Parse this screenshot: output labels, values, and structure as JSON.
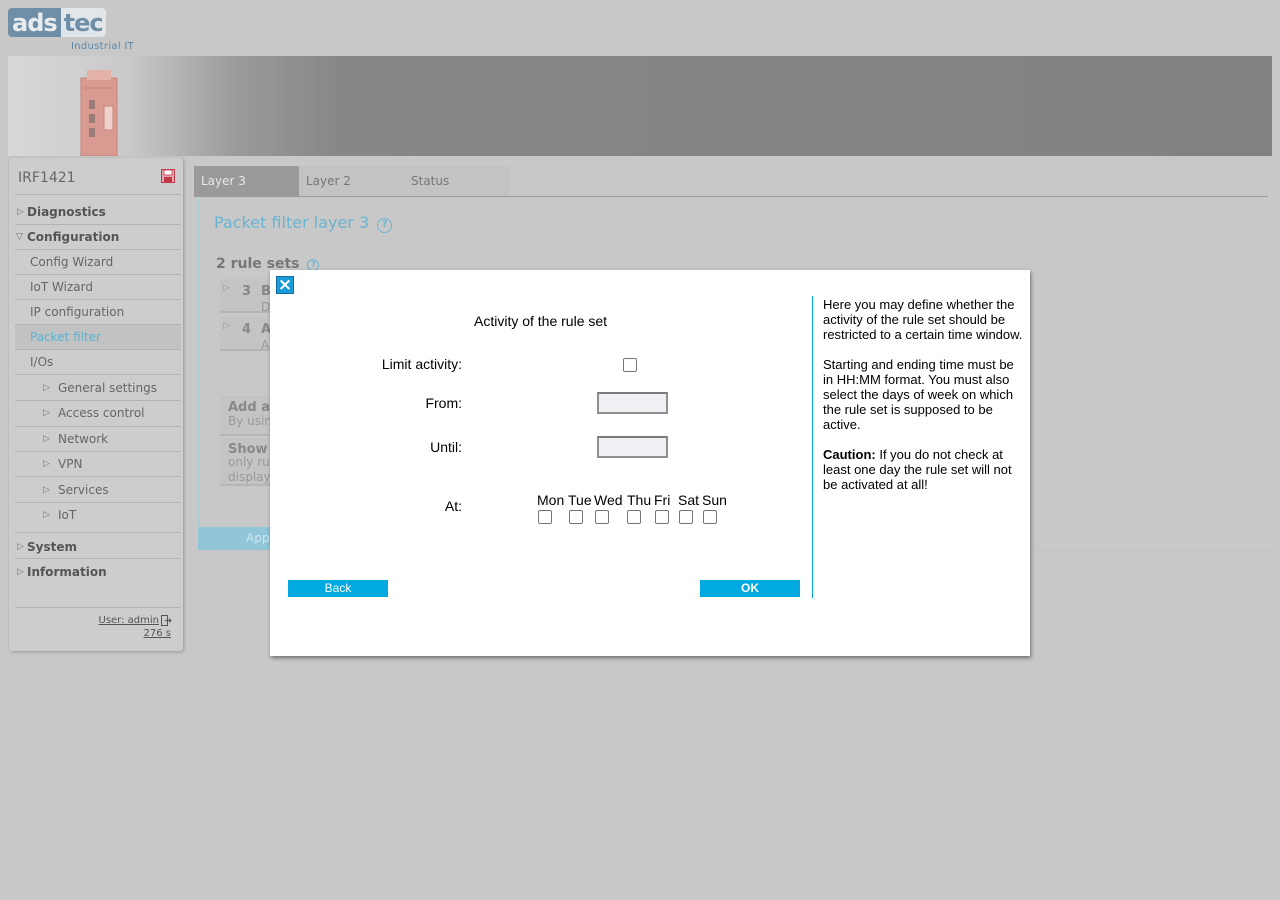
{
  "brand": {
    "logo_left": "ads",
    "logo_right": "tec",
    "tagline": "Industrial IT"
  },
  "colors": {
    "accent": "#00a9e0",
    "title_blue": "#6ab4cf",
    "close_blue": "#1a9bd7"
  },
  "sidebar": {
    "device_name": "IRF1421",
    "items": [
      {
        "label": "Diagnostics",
        "level": "top",
        "expanded": false
      },
      {
        "label": "Configuration",
        "level": "top",
        "expanded": true
      },
      {
        "label": "Config Wizard",
        "level": "sub"
      },
      {
        "label": "IoT Wizard",
        "level": "sub"
      },
      {
        "label": "IP configuration",
        "level": "sub"
      },
      {
        "label": "Packet filter",
        "level": "sub",
        "active": true
      },
      {
        "label": "I/Os",
        "level": "sub"
      },
      {
        "label": "General settings",
        "level": "sub2"
      },
      {
        "label": "Access control",
        "level": "sub2"
      },
      {
        "label": "Network",
        "level": "sub2"
      },
      {
        "label": "VPN",
        "level": "sub2"
      },
      {
        "label": "Services",
        "level": "sub2"
      },
      {
        "label": "IoT",
        "level": "sub2"
      },
      {
        "label": "System",
        "level": "top",
        "expanded": false
      },
      {
        "label": "Information",
        "level": "top",
        "expanded": false
      }
    ],
    "user": "User: admin",
    "timer": "276 s"
  },
  "tabs": [
    {
      "label": "Layer 3",
      "active": true
    },
    {
      "label": "Layer 2",
      "active": false
    },
    {
      "label": "Status",
      "active": false
    }
  ],
  "main": {
    "title": "Packet filter layer 3",
    "ruleset_heading": "2 rule sets",
    "rules": [
      {
        "num": "3",
        "name": "B",
        "desc": "D"
      },
      {
        "num": "4",
        "name": "A",
        "desc": "A"
      }
    ],
    "add_box": {
      "title": "Add a",
      "line1": "By usin"
    },
    "show_box": {
      "title": "Show",
      "line1": "only ru",
      "line2": "display"
    },
    "apply_label": "Appl"
  },
  "modal": {
    "close_label": "×",
    "title": "Activity of the rule set",
    "limit_label": "Limit activity:",
    "limit_checked": false,
    "from_label": "From:",
    "from_value": "",
    "until_label": "Until:",
    "until_value": "",
    "at_label": "At:",
    "days": [
      "Mon",
      "Tue",
      "Wed",
      "Thu",
      "Fri",
      "Sat",
      "Sun"
    ],
    "back_label": "Back",
    "ok_label": "OK",
    "help": {
      "p1": "Here you may define whether the activity of the rule set should be restricted to a certain time window.",
      "p2": "Starting and ending time must be in HH:MM format. You must also select the days of week on which the rule set is supposed to be active.",
      "caution_label": "Caution:",
      "caution_text": " If you do not check at least one day the rule set will not be activated at all!"
    }
  }
}
